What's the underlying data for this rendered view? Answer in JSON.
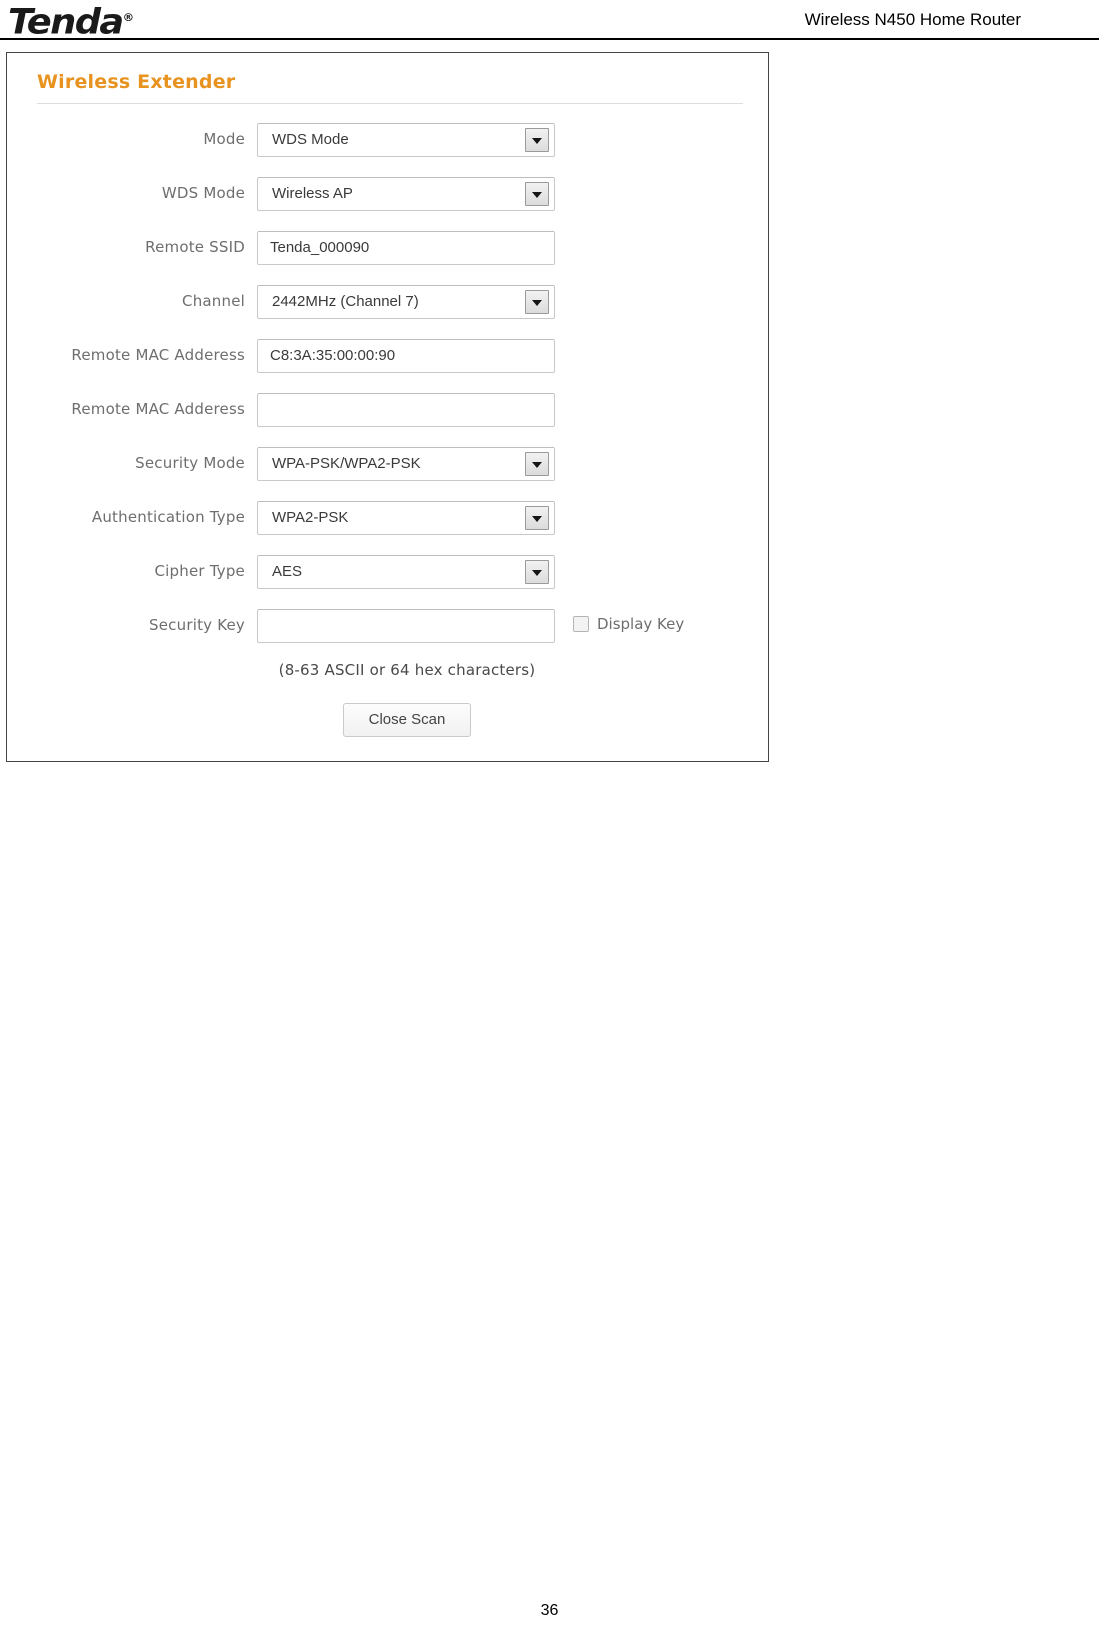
{
  "header": {
    "brand": "Tenda",
    "brand_trademark": "®",
    "document_title": "Wireless N450 Home Router"
  },
  "panel": {
    "title": "Wireless Extender",
    "rows": [
      {
        "label": "Mode",
        "value": "WDS Mode",
        "control": "select",
        "name": "mode"
      },
      {
        "label": "WDS Mode",
        "value": "Wireless AP",
        "control": "select",
        "name": "wds-mode"
      },
      {
        "label": "Remote SSID",
        "value": "Tenda_000090",
        "control": "text",
        "name": "remote-ssid"
      },
      {
        "label": "Channel",
        "value": "2442MHz (Channel 7)",
        "control": "select",
        "name": "channel"
      },
      {
        "label": "Remote MAC Adderess",
        "value": "C8:3A:35:00:00:90",
        "control": "text",
        "name": "remote-mac-address-1"
      },
      {
        "label": "Remote MAC Adderess",
        "value": "",
        "control": "text",
        "name": "remote-mac-address-2"
      },
      {
        "label": "Security Mode",
        "value": "WPA-PSK/WPA2-PSK",
        "control": "select",
        "name": "security-mode"
      },
      {
        "label": "Authentication Type",
        "value": "WPA2-PSK",
        "control": "select",
        "name": "authentication-type"
      },
      {
        "label": "Cipher Type",
        "value": "AES",
        "control": "select",
        "name": "cipher-type"
      },
      {
        "label": "Security Key",
        "value": "",
        "control": "text",
        "name": "security-key"
      }
    ],
    "display_key_label": "Display Key",
    "display_key_checked": false,
    "security_key_hint": "(8-63 ASCII or 64 hex characters)",
    "close_scan_label": "Close Scan"
  },
  "footer": {
    "page_number": "36"
  },
  "colors": {
    "panel_title": "#e8921f",
    "label_text": "#6e6e6e",
    "value_text": "#3a3a3a",
    "panel_border": "#444444"
  }
}
